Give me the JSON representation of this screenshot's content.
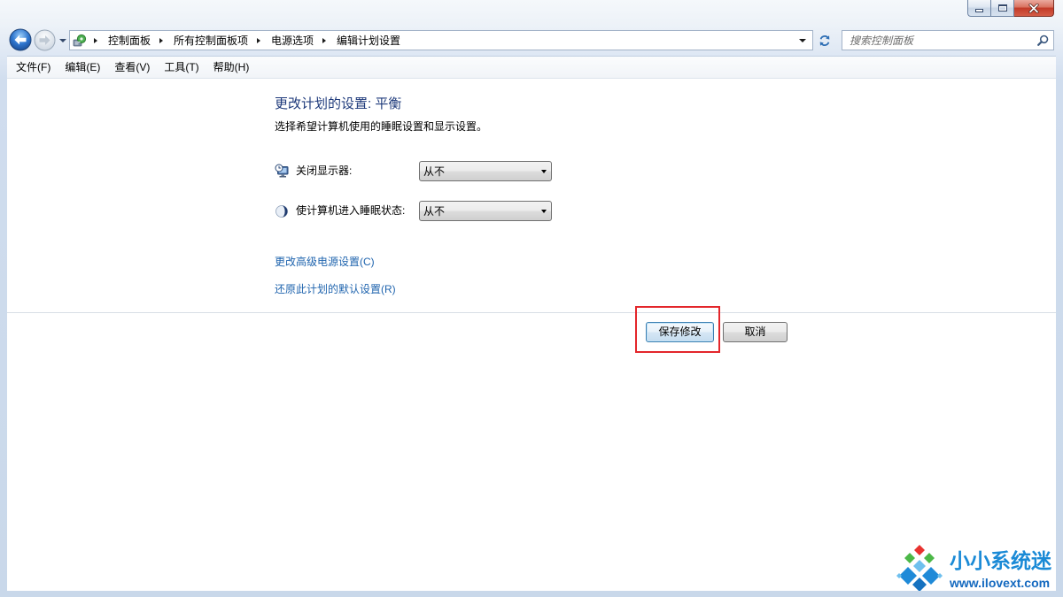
{
  "window": {
    "controls": {
      "minimize_icon": "minimize-icon",
      "maximize_icon": "maximize-icon",
      "close_icon": "close-icon"
    }
  },
  "navigation": {
    "back_icon": "back-arrow-icon",
    "forward_icon": "forward-arrow-icon",
    "history_icon": "chevron-down-icon",
    "location_icon": "control-panel-icon",
    "breadcrumb": [
      "控制面板",
      "所有控制面板项",
      "电源选项",
      "编辑计划设置"
    ],
    "refresh_icon": "refresh-icon",
    "search_placeholder": "搜索控制面板",
    "search_icon": "search-icon"
  },
  "menu": [
    {
      "label": "文件(F)"
    },
    {
      "label": "编辑(E)"
    },
    {
      "label": "查看(V)"
    },
    {
      "label": "工具(T)"
    },
    {
      "label": "帮助(H)"
    }
  ],
  "plan_settings": {
    "title": "更改计划的设置: 平衡",
    "description": "选择希望计算机使用的睡眠设置和显示设置。",
    "settings": [
      {
        "icon": "monitor-clock-icon",
        "label": "关闭显示器:",
        "value": "从不"
      },
      {
        "icon": "moon-icon",
        "label": "使计算机进入睡眠状态:",
        "value": "从不"
      }
    ],
    "links": [
      {
        "label": "更改高级电源设置(C)"
      },
      {
        "label": "还原此计划的默认设置(R)"
      }
    ]
  },
  "actions": {
    "save_label": "保存修改",
    "cancel_label": "取消"
  },
  "watermark": {
    "name": "小小系统迷",
    "url": "www.ilovext.com"
  },
  "colors": {
    "title": "#1e3a7b",
    "link": "#1f64ae",
    "watermark_name": "#1a8ad6",
    "watermark_url": "#1469bf",
    "close_button": "#c23a28",
    "highlight": "#e3262b"
  }
}
